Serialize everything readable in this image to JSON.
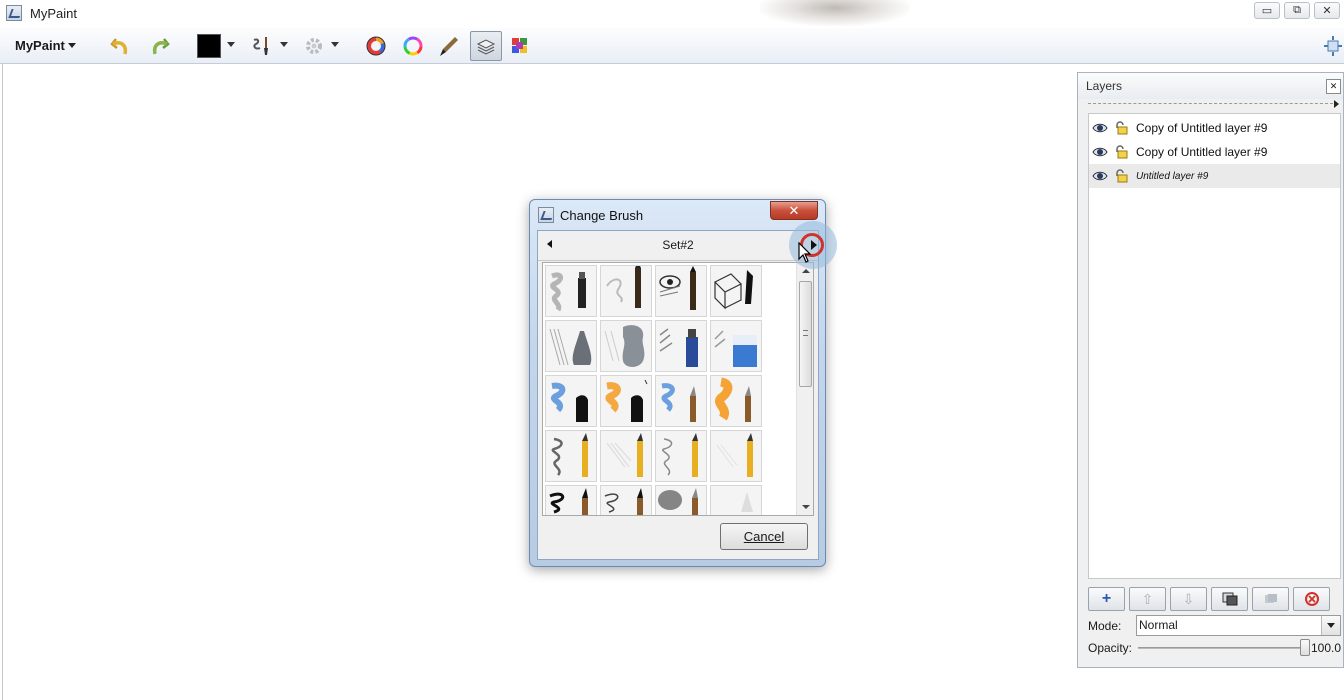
{
  "window": {
    "title": "MyPaint",
    "controls": [
      "minimize",
      "restore",
      "close"
    ]
  },
  "toolbar": {
    "menu_label": "MyPaint",
    "icons": [
      "undo-icon",
      "redo-icon",
      "color-swatch",
      "brush-icon",
      "settings-icon",
      "color-wheel-icon",
      "hue-ring-icon",
      "pen-icon",
      "layers-toggle-icon",
      "palette-icon"
    ],
    "color": "#000000"
  },
  "dialog": {
    "title": "Change Brush",
    "close_label": "✕",
    "set_label": "Set#2",
    "cancel_label": "Cancel",
    "brushes": [
      "charcoal",
      "pencil-soft",
      "pencil-sketch",
      "ink-pen",
      "blender",
      "eraser-soft",
      "marker-blue",
      "eraser-block",
      "pen-blue",
      "pen-orange",
      "brush-blue",
      "brush-orange",
      "pencil-yellow-1",
      "pencil-yellow-2",
      "pencil-yellow-3",
      "pencil-yellow-4",
      "ink-scribble",
      "ink-thin",
      "smudge",
      "airbrush"
    ]
  },
  "layers": {
    "title": "Layers",
    "items": [
      {
        "name": "Copy of Untitled layer #9",
        "italic": false,
        "selected": false
      },
      {
        "name": "Copy of Untitled layer #9",
        "italic": false,
        "selected": false
      },
      {
        "name": "Untitled layer #9",
        "italic": true,
        "selected": true
      }
    ],
    "buttons": [
      "add-layer",
      "move-up",
      "move-down",
      "duplicate",
      "merge",
      "delete"
    ],
    "mode_label": "Mode:",
    "mode_value": "Normal",
    "opacity_label": "Opacity:",
    "opacity_value": "100.0"
  }
}
